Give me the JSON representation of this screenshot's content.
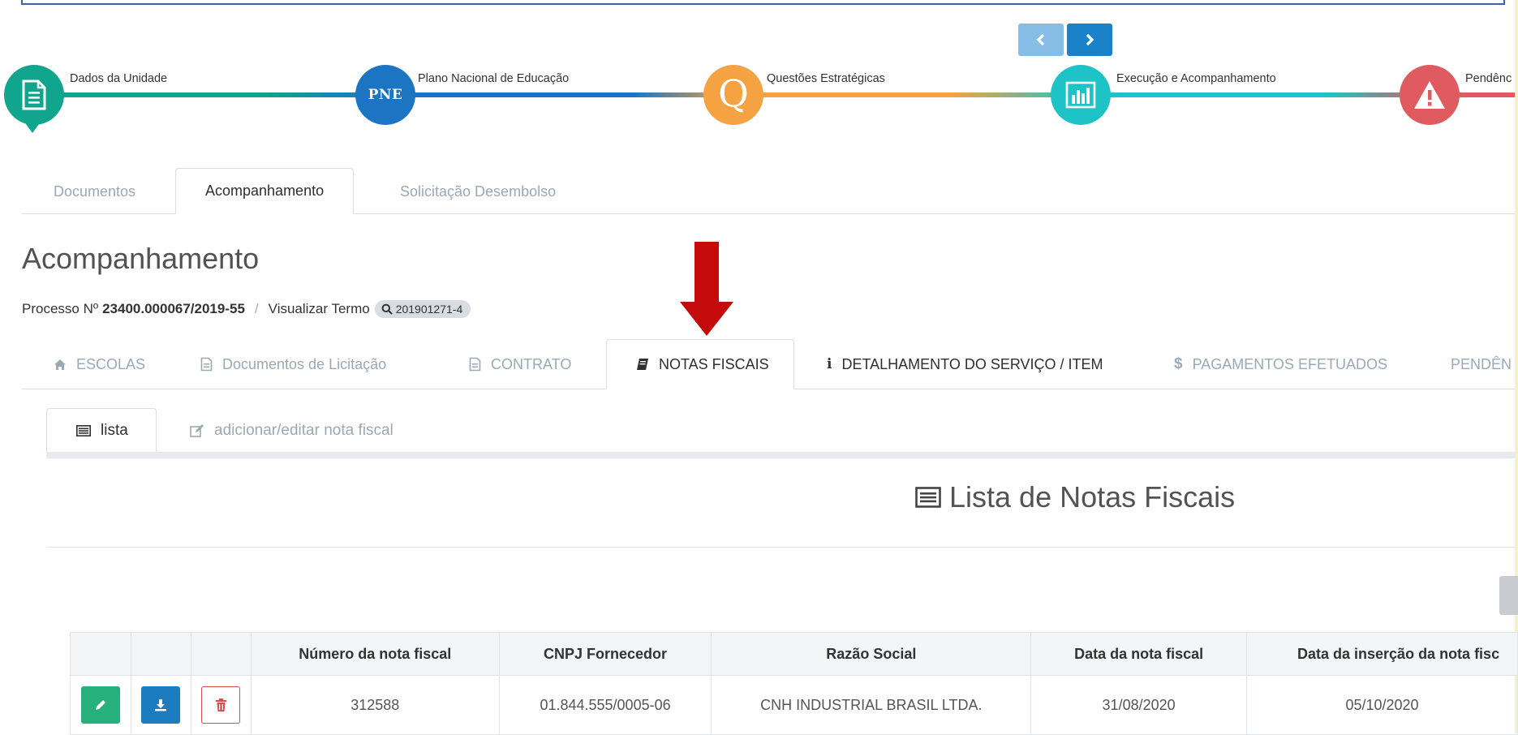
{
  "steps": [
    {
      "label": "Dados da Unidade",
      "icon": "document-icon",
      "color": "#12a58e"
    },
    {
      "label": "Plano Nacional de Educação",
      "icon_text": "PNE",
      "color": "#1b75c2"
    },
    {
      "label": "Questões Estratégicas",
      "icon_text": "Q",
      "color": "#f5a243"
    },
    {
      "label": "Execução e Acompanhamento",
      "icon": "bar-chart-icon",
      "color": "#1ec3c7"
    },
    {
      "label": "Pendênc",
      "icon": "warning-icon",
      "color": "#e05b5f"
    }
  ],
  "top_tabs": [
    "Documentos",
    "Acompanhamento",
    "Solicitação Desembolso"
  ],
  "page_title": "Acompanhamento",
  "breadcrumb": {
    "processo_prefix": "Processo Nº",
    "processo_num": "23400.000067/2019-55",
    "separator": "/",
    "visualizar": "Visualizar Termo",
    "termo": "201901271-4"
  },
  "section_tabs": [
    "ESCOLAS",
    "Documentos de Licitação",
    "CONTRATO",
    "NOTAS FISCAIS",
    "DETALHAMENTO DO SERVIÇO / ITEM",
    "PAGAMENTOS EFETUADOS",
    "PENDÊN"
  ],
  "sub_tabs": [
    "lista",
    "adicionar/editar nota fiscal"
  ],
  "list_title": "Lista de Notas Fiscais",
  "table": {
    "headers": [
      "Número da nota fiscal",
      "CNPJ Fornecedor",
      "Razão Social",
      "Data da nota fiscal",
      "Data da inserção da nota fisc"
    ],
    "rows": [
      [
        "312588",
        "01.844.555/0005-06",
        "CNH INDUSTRIAL BRASIL LTDA.",
        "31/08/2020",
        "05/10/2020"
      ]
    ]
  },
  "colors": {
    "accent_red_arrow": "#c40a0a",
    "edit_button": "#25b07c",
    "download_button": "#1b7dc0",
    "delete_button_border": "#e0494a"
  }
}
